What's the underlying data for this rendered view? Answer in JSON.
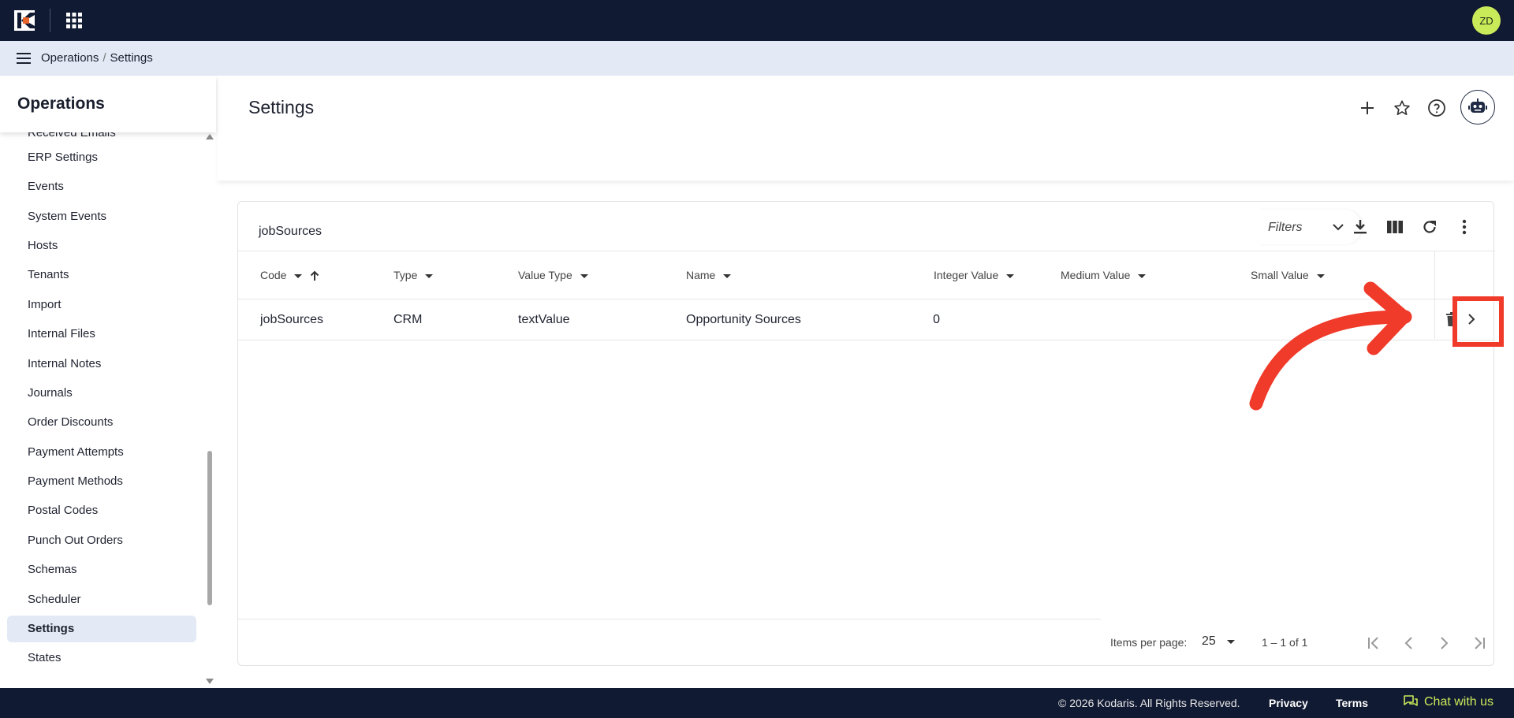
{
  "header": {
    "avatar_initials": "ZD"
  },
  "breadcrumb": {
    "items": [
      "Operations",
      "Settings"
    ],
    "separator": "/"
  },
  "sidebar": {
    "title": "Operations",
    "items": [
      {
        "label": "Received Emails"
      },
      {
        "label": "ERP Settings"
      },
      {
        "label": "Events"
      },
      {
        "label": "System Events"
      },
      {
        "label": "Hosts"
      },
      {
        "label": "Tenants"
      },
      {
        "label": "Import"
      },
      {
        "label": "Internal Files"
      },
      {
        "label": "Internal Notes"
      },
      {
        "label": "Journals"
      },
      {
        "label": "Order Discounts"
      },
      {
        "label": "Payment Attempts"
      },
      {
        "label": "Payment Methods"
      },
      {
        "label": "Postal Codes"
      },
      {
        "label": "Punch Out Orders"
      },
      {
        "label": "Schemas"
      },
      {
        "label": "Scheduler"
      },
      {
        "label": "Settings",
        "active": true
      },
      {
        "label": "States"
      }
    ]
  },
  "page": {
    "title": "Settings"
  },
  "table": {
    "title": "jobSources",
    "filters_label": "Filters",
    "columns": [
      "Code",
      "Type",
      "Value Type",
      "Name",
      "Integer Value",
      "Medium Value",
      "Small Value"
    ],
    "rows": [
      {
        "code": "jobSources",
        "type": "CRM",
        "value_type": "textValue",
        "name": "Opportunity Sources",
        "integer_value": "0",
        "medium_value": "",
        "small_value": ""
      }
    ]
  },
  "pagination": {
    "items_per_page_label": "Items per page:",
    "items_per_page": "25",
    "range": "1 – 1 of 1"
  },
  "footer": {
    "copyright": "© 2026 Kodaris. All Rights Reserved.",
    "privacy": "Privacy",
    "terms": "Terms",
    "chat": "Chat with us"
  },
  "colors": {
    "topbar": "#111a33",
    "accent": "#c9ea59",
    "logo_orange": "#e8662b",
    "highlight_red": "#f03a2a"
  }
}
